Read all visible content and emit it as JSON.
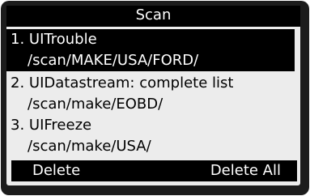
{
  "title": "Scan",
  "items": [
    {
      "label": "1. UITrouble",
      "path": "/scan/MAKE/USA/FORD/"
    },
    {
      "label": "2. UIDatastream: complete list",
      "path": "/scan/make/EOBD/"
    },
    {
      "label": "3. UIFreeze",
      "path": "/scan/make/USA/"
    }
  ],
  "softkeys": {
    "left": "Delete",
    "right": "Delete All"
  },
  "colors": {
    "bezel": "#1c1c1c",
    "screen": "#ececec",
    "highlight": "#000000",
    "highlight_text": "#ffffff"
  }
}
